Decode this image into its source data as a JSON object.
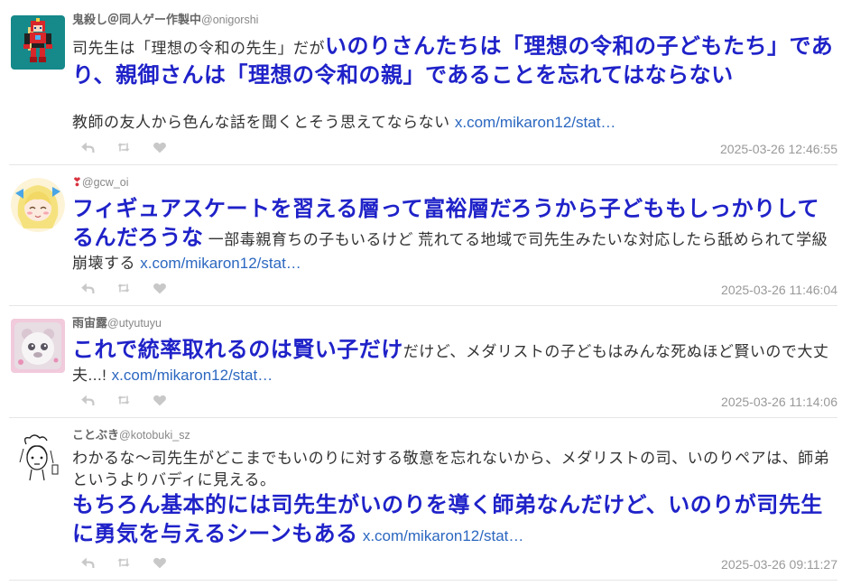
{
  "tweets": [
    {
      "user": {
        "name": "鬼殺し＠同人ゲー作製中",
        "handle": "@onigorshi"
      },
      "body": [
        {
          "plain": "司先生は「理想の令和の先生」だが"
        },
        {
          "highlight": "いのりさんたちは「理想の令和の子どもたち」であり、親御さんは「理想の令和の親」であることを忘れてはならない"
        },
        {
          "plain": "\n\n教師の友人から色んな話を聞くとそう思えてならない"
        },
        {
          "link": "x.com/mikaron12/stat…"
        }
      ],
      "timestamp": "2025-03-26 12:46:55"
    },
    {
      "user": {
        "name": "❣",
        "handle": "@gcw_oi"
      },
      "body": [
        {
          "highlight": "フィギュアスケートを習える層って富裕層だろうから子どももしっかりしてるんだろうな"
        },
        {
          "plain": "一部毒親育ちの子もいるけど 荒れてる地域で司先生みたいな対応したら舐められて学級崩壊する"
        },
        {
          "link": "x.com/mikaron12/stat…"
        }
      ],
      "timestamp": "2025-03-26 11:46:04"
    },
    {
      "user": {
        "name": "雨宙露",
        "handle": "@utyutuyu"
      },
      "body": [
        {
          "highlight": "これで統率取れるのは賢い子だけ"
        },
        {
          "plain": "だけど、メダリストの子どもはみんな死ぬほど賢いので大丈夫...!"
        },
        {
          "link": "x.com/mikaron12/stat…"
        }
      ],
      "timestamp": "2025-03-26 11:14:06"
    },
    {
      "user": {
        "name": "ことぶき",
        "handle": "@kotobuki_sz"
      },
      "body": [
        {
          "plain": "わかるな～司先生がどこまでもいのりに対する敬意を忘れないから、メダリストの司、いのりペアは、師弟というよりバディに見える。\n"
        },
        {
          "highlight": "もちろん基本的には司先生がいのりを導く師弟なんだけど、いのりが司先生に勇気を与えるシーンもある"
        },
        {
          "link": "x.com/mikaron12/stat…"
        }
      ],
      "timestamp": "2025-03-26 09:11:27"
    }
  ],
  "icons": {
    "reply": "reply-icon",
    "retweet": "retweet-icon",
    "like": "heart-icon"
  },
  "colors": {
    "text": "#333333",
    "highlight": "#1f22c8",
    "link": "#2b67c0",
    "meta": "#888888",
    "name": "#666666",
    "time": "#999999",
    "icon": "#c8c8c8",
    "divider": "#e6e6e6"
  }
}
